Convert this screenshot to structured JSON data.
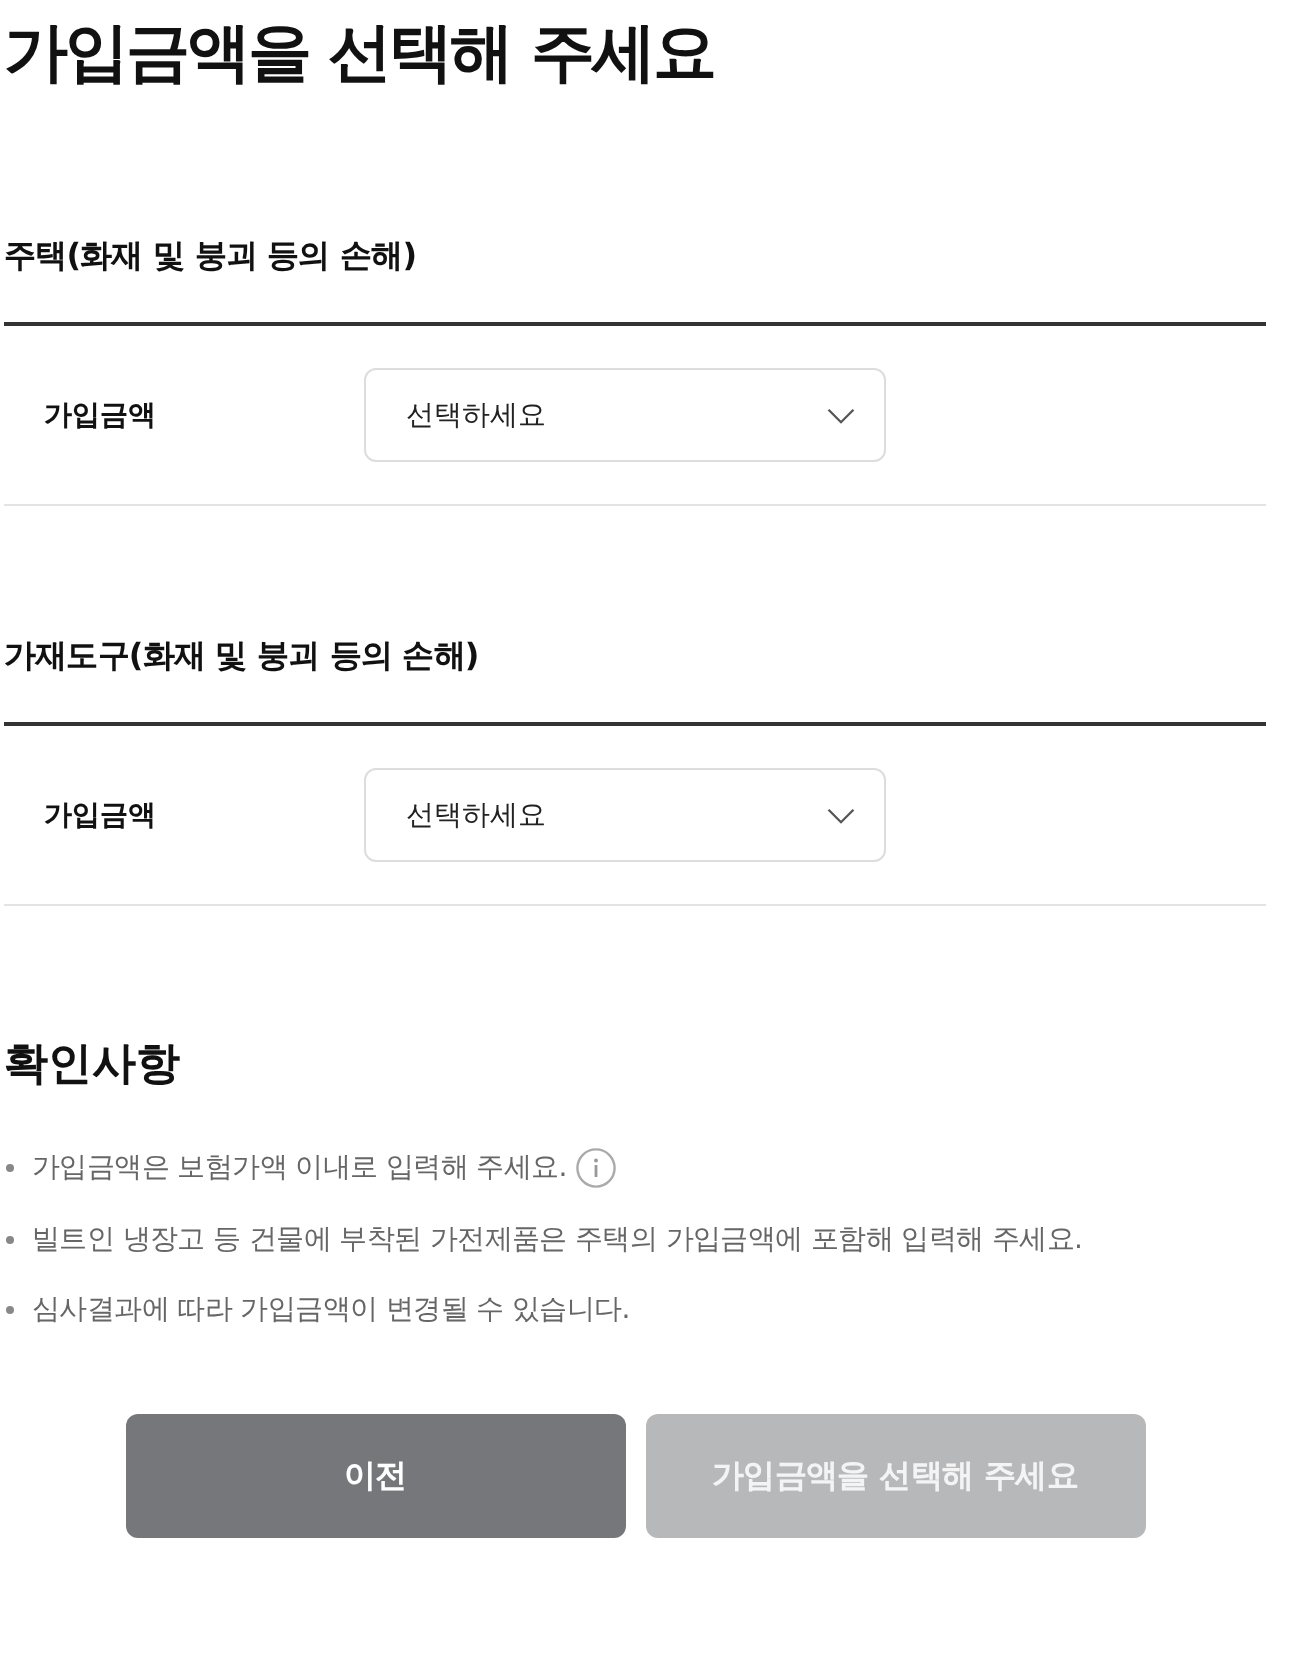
{
  "page": {
    "title": "가입금액을 선택해 주세요"
  },
  "sections": [
    {
      "heading": "주택(화재 및 붕괴 등의 손해)",
      "fields": [
        {
          "label": "가입금액",
          "placeholder": "선택하세요"
        }
      ]
    },
    {
      "heading": "가재도구(화재 및 붕괴 등의 손해)",
      "fields": [
        {
          "label": "가입금액",
          "placeholder": "선택하세요"
        }
      ]
    }
  ],
  "notice": {
    "heading": "확인사항",
    "items": [
      {
        "text": "가입금액은 보험가액 이내로 입력해 주세요.",
        "info_icon": true
      },
      {
        "text": "빌트인 냉장고 등 건물에 부착된 가전제품은 주택의 가입금액에 포함해 입력해 주세요.",
        "info_icon": false
      },
      {
        "text": "심사결과에 따라 가입금액이 변경될 수 있습니다.",
        "info_icon": false
      }
    ]
  },
  "buttons": [
    {
      "label": "이전",
      "disabled": false
    },
    {
      "label": "가입금액을 선택해 주세요",
      "disabled": true
    }
  ]
}
